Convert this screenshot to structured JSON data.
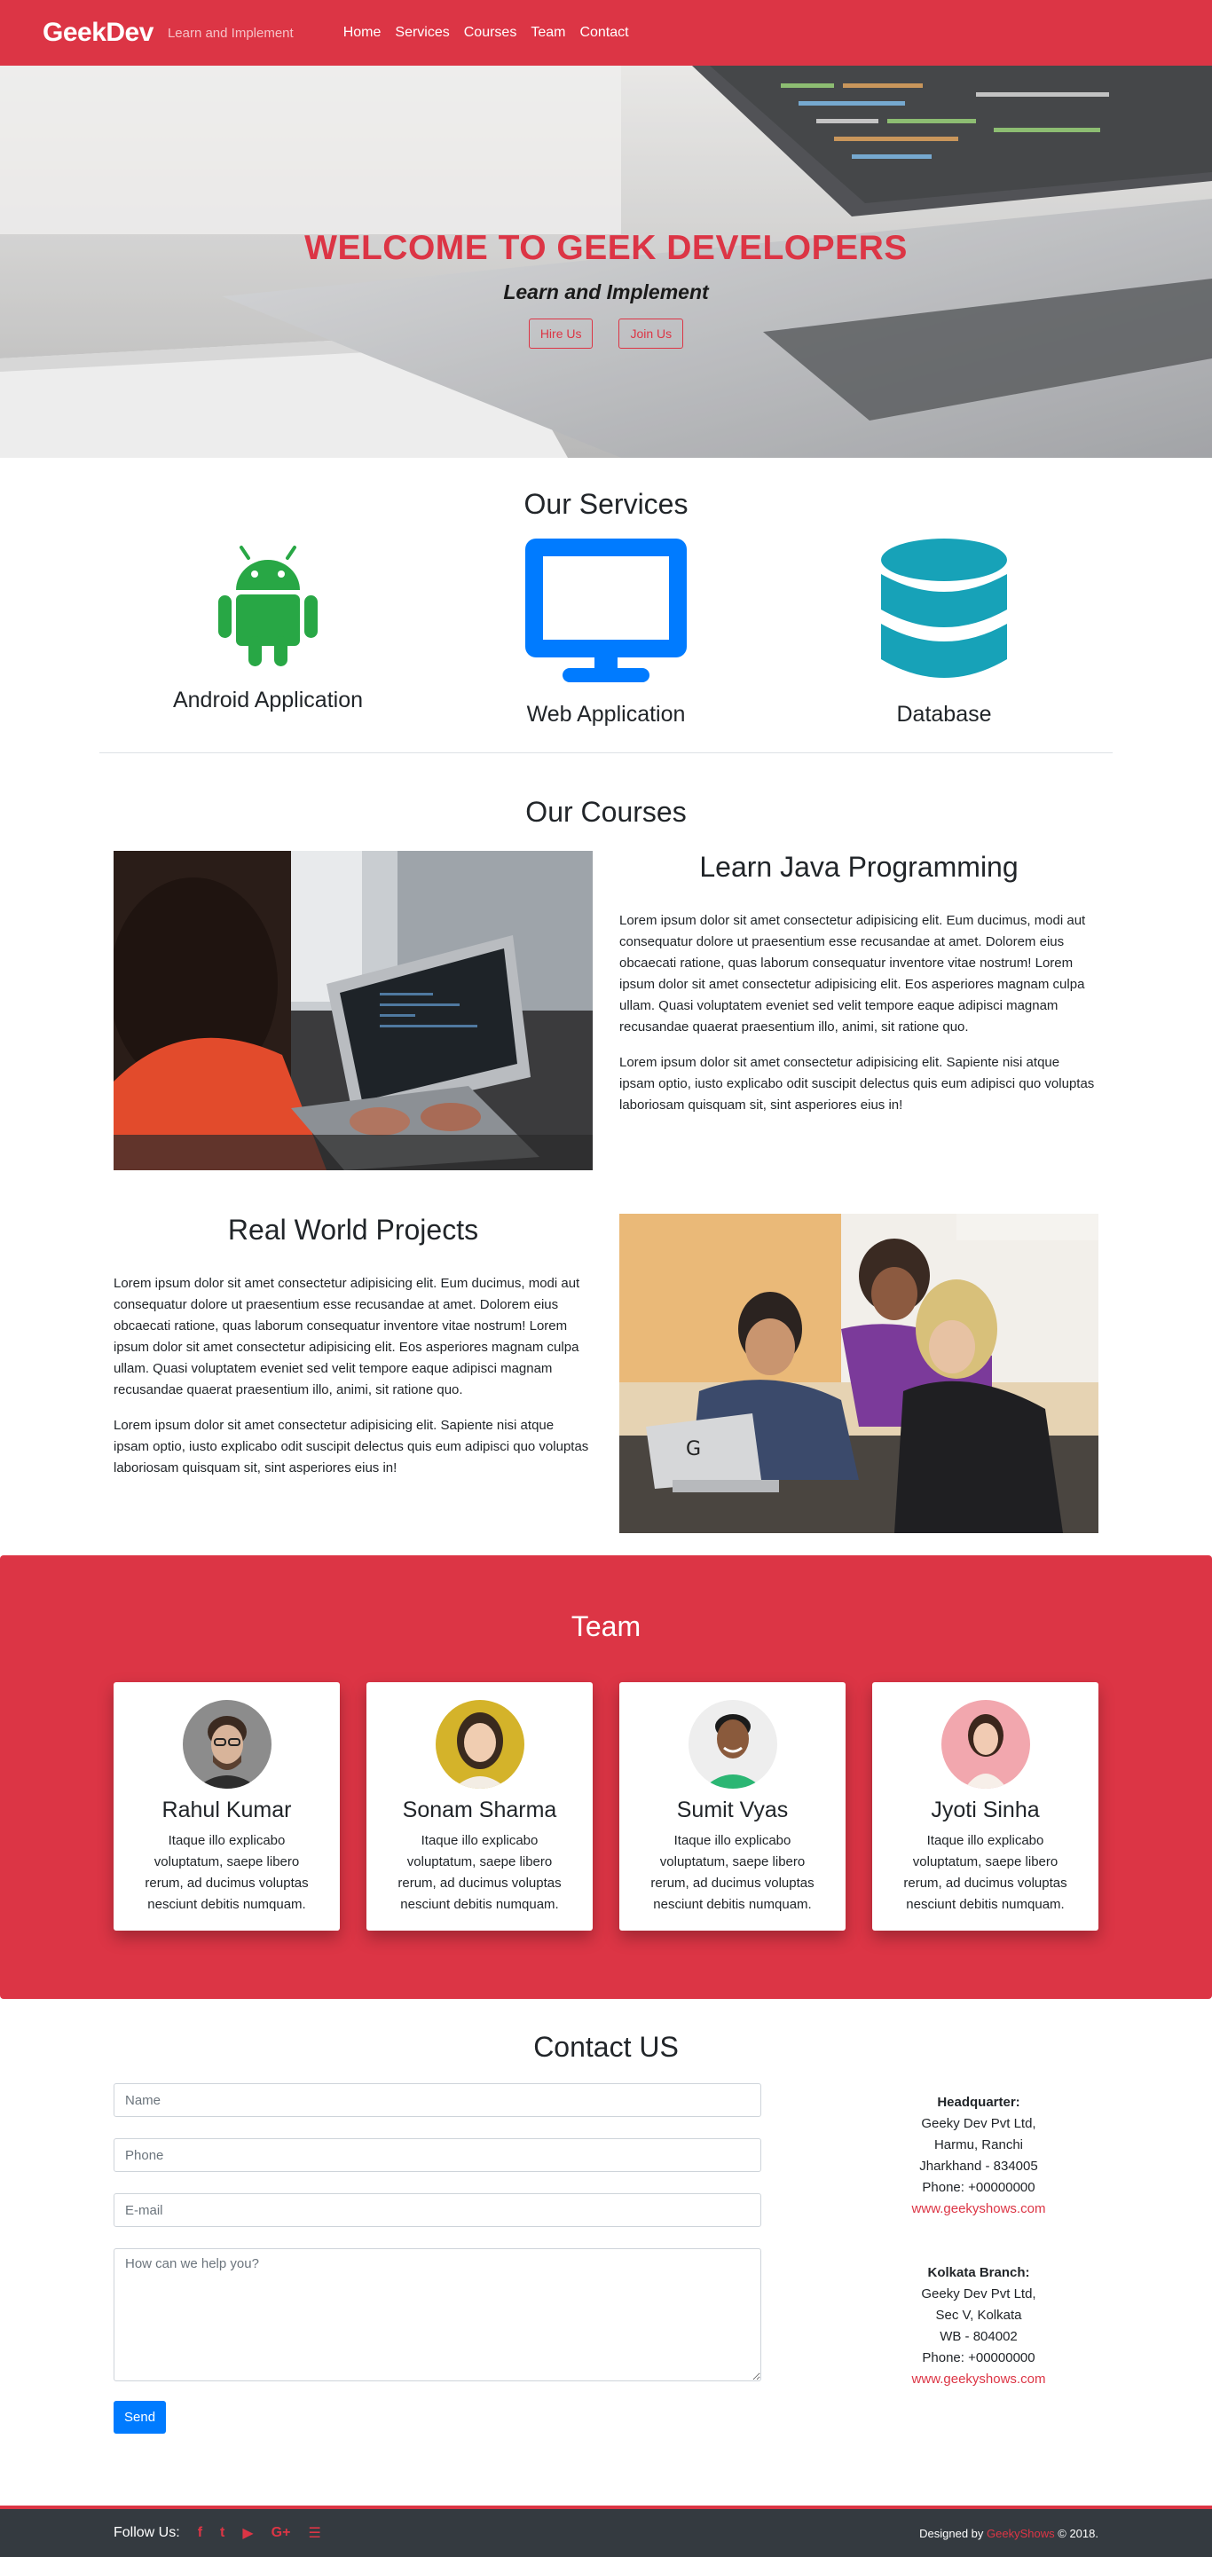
{
  "navbar": {
    "brand": "GeekDev",
    "tagline": "Learn and Implement",
    "links": [
      "Home",
      "Services",
      "Courses",
      "Team",
      "Contact"
    ]
  },
  "hero": {
    "title": "WELCOME TO GEEK DEVELOPERS",
    "subtitle": "Learn and Implement",
    "hire_label": "Hire Us",
    "join_label": "Join Us"
  },
  "services": {
    "title": "Our Services",
    "items": [
      {
        "label": "Android Application",
        "icon": "android-icon",
        "color": "#28a745"
      },
      {
        "label": "Web Application",
        "icon": "monitor-icon",
        "color": "#007bff"
      },
      {
        "label": "Database",
        "icon": "database-icon",
        "color": "#17a2b8"
      }
    ]
  },
  "courses": {
    "title": "Our Courses",
    "items": [
      {
        "heading": "Learn Java Programming",
        "para1": "Lorem ipsum dolor sit amet consectetur adipisicing elit. Eum ducimus, modi aut consequatur dolore ut praesentium esse recusandae at amet. Dolorem eius obcaecati ratione, quas laborum consequatur inventore vitae nostrum! Lorem ipsum dolor sit amet consectetur adipisicing elit. Eos asperiores magnam culpa ullam. Quasi voluptatem eveniet sed velit tempore eaque adipisci magnam recusandae quaerat praesentium illo, animi, sit ratione quo.",
        "para2": "Lorem ipsum dolor sit amet consectetur adipisicing elit. Sapiente nisi atque ipsam optio, iusto explicabo odit suscipit delectus quis eum adipisci quo voluptas laboriosam quisquam sit, sint asperiores eius in!"
      },
      {
        "heading": "Real World Projects",
        "para1": "Lorem ipsum dolor sit amet consectetur adipisicing elit. Eum ducimus, modi aut consequatur dolore ut praesentium esse recusandae at amet. Dolorem eius obcaecati ratione, quas laborum consequatur inventore vitae nostrum! Lorem ipsum dolor sit amet consectetur adipisicing elit. Eos asperiores magnam culpa ullam. Quasi voluptatem eveniet sed velit tempore eaque adipisci magnam recusandae quaerat praesentium illo, animi, sit ratione quo.",
        "para2": "Lorem ipsum dolor sit amet consectetur adipisicing elit. Sapiente nisi atque ipsam optio, iusto explicabo odit suscipit delectus quis eum adipisci quo voluptas laboriosam quisquam sit, sint asperiores eius in!"
      }
    ]
  },
  "team": {
    "title": "Team",
    "members": [
      {
        "name": "Rahul Kumar",
        "desc": "Itaque illo explicabo voluptatum, saepe libero rerum, ad ducimus voluptas nesciunt debitis numquam."
      },
      {
        "name": "Sonam Sharma",
        "desc": "Itaque illo explicabo voluptatum, saepe libero rerum, ad ducimus voluptas nesciunt debitis numquam."
      },
      {
        "name": "Sumit Vyas",
        "desc": "Itaque illo explicabo voluptatum, saepe libero rerum, ad ducimus voluptas nesciunt debitis numquam."
      },
      {
        "name": "Jyoti Sinha",
        "desc": "Itaque illo explicabo voluptatum, saepe libero rerum, ad ducimus voluptas nesciunt debitis numquam."
      }
    ]
  },
  "contact": {
    "title": "Contact US",
    "name_placeholder": "Name",
    "phone_placeholder": "Phone",
    "email_placeholder": "E-mail",
    "message_placeholder": "How can we help you?",
    "send_label": "Send",
    "offices": [
      {
        "title": "Headquarter:",
        "line1": "Geeky Dev Pvt Ltd,",
        "line2": "Harmu, Ranchi",
        "line3": "Jharkhand - 834005",
        "phone": "Phone: +00000000",
        "website": "www.geekyshows.com"
      },
      {
        "title": "Kolkata Branch:",
        "line1": "Geeky Dev Pvt Ltd,",
        "line2": "Sec V, Kolkata",
        "line3": "WB - 804002",
        "phone": "Phone: +00000000",
        "website": "www.geekyshows.com"
      }
    ]
  },
  "footer": {
    "follow_label": "Follow Us:",
    "socials": [
      {
        "icon": "facebook-icon",
        "glyph": "f"
      },
      {
        "icon": "twitter-icon",
        "glyph": "t"
      },
      {
        "icon": "youtube-icon",
        "glyph": "▶"
      },
      {
        "icon": "google-plus-icon",
        "glyph": "G+"
      },
      {
        "icon": "rss-icon",
        "glyph": "☰"
      }
    ],
    "credit_prefix": "Designed by",
    "credit_link": "GeekyShows",
    "credit_suffix": "© 2018."
  }
}
